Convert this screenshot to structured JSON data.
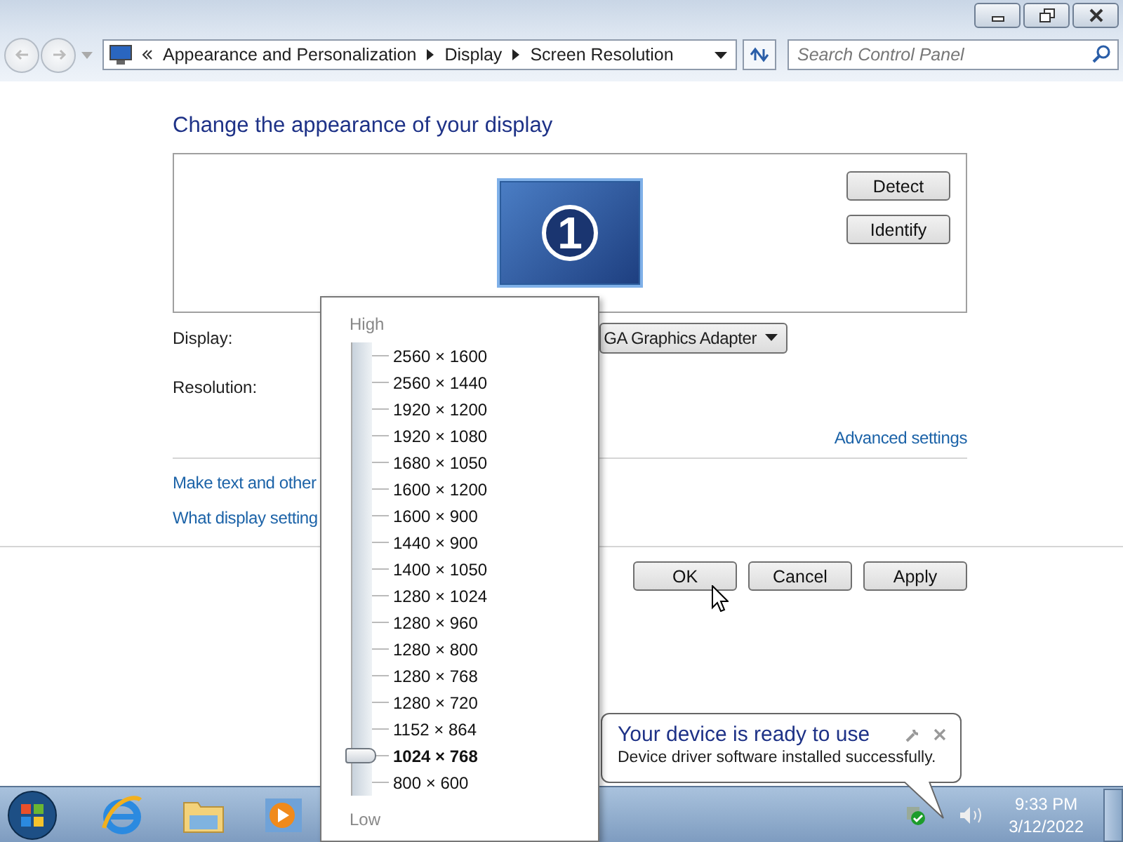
{
  "address_bar": {
    "breadcrumbs": [
      "Appearance and Personalization",
      "Display",
      "Screen Resolution"
    ]
  },
  "search": {
    "placeholder": "Search Control Panel"
  },
  "heading": "Change the appearance of your display",
  "monitor": {
    "number": "1"
  },
  "preview_buttons": [
    "Detect",
    "Identify"
  ],
  "fields": [
    {
      "label": "Display:",
      "value": "GA Graphics Adapter"
    },
    {
      "label": "Resolution:"
    }
  ],
  "advanced_link": "Advanced settings",
  "links": [
    "Make text and other",
    "What display setting"
  ],
  "buttons": [
    "OK",
    "Cancel",
    "Apply"
  ],
  "resolution_popup": {
    "high_label": "High",
    "low_label": "Low",
    "options": [
      {
        "label": "2560 × 1600",
        "selected": false
      },
      {
        "label": "2560 × 1440",
        "selected": false
      },
      {
        "label": "1920 × 1200",
        "selected": false
      },
      {
        "label": "1920 × 1080",
        "selected": false
      },
      {
        "label": "1680 × 1050",
        "selected": false
      },
      {
        "label": "1600 × 1200",
        "selected": false
      },
      {
        "label": "1600 × 900",
        "selected": false
      },
      {
        "label": "1440 × 900",
        "selected": false
      },
      {
        "label": "1400 × 1050",
        "selected": false
      },
      {
        "label": "1280 × 1024",
        "selected": false
      },
      {
        "label": "1280 × 960",
        "selected": false
      },
      {
        "label": "1280 × 800",
        "selected": false
      },
      {
        "label": "1280 × 768",
        "selected": false
      },
      {
        "label": "1280 × 720",
        "selected": false
      },
      {
        "label": "1152 × 864",
        "selected": false
      },
      {
        "label": "1024 × 768",
        "selected": true
      },
      {
        "label": "800 × 600",
        "selected": false
      }
    ]
  },
  "notification": {
    "title": "Your device is ready to use",
    "message": "Device driver software installed successfully."
  },
  "taskbar": {
    "clock": {
      "time": "9:33 PM",
      "date": "3/12/2022"
    }
  }
}
